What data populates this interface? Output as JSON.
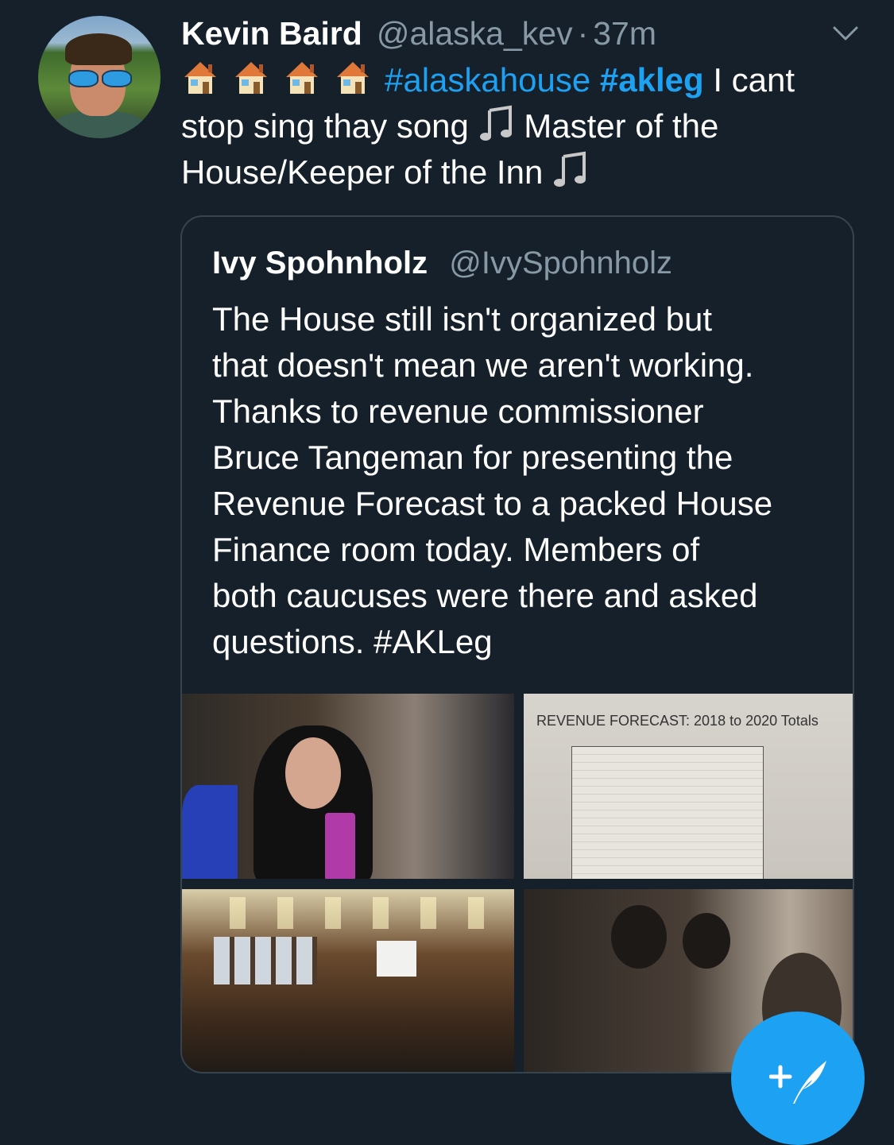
{
  "tweet": {
    "author_name": "Kevin Baird",
    "author_handle": "@alaska_kev",
    "separator": "·",
    "time": "37m",
    "text_hashtag_1": "#alaskahouse",
    "text_hashtag_2": "#akleg",
    "text_after_hashtags": "I cant",
    "text_line_2": "stop sing thay song",
    "text_line_2_after_note": "Master of the",
    "text_line_3": "House/Keeper of the Inn",
    "emojis": [
      "house-emoji",
      "house-emoji",
      "house-emoji",
      "house-emoji",
      "musical-notes-emoji",
      "musical-notes-emoji"
    ]
  },
  "quoted_tweet": {
    "author_name": "Ivy Spohnholz",
    "author_handle": "@IvySpohnholz",
    "text_lines": [
      "The House still isn't organized but",
      "that doesn't mean we aren't working.",
      "Thanks to revenue commissioner",
      "Bruce Tangeman for presenting the",
      "Revenue Forecast to a packed House",
      "Finance room today. Members of",
      "both caucuses were there and asked",
      "questions."
    ],
    "hashtag": "#AKLeg",
    "media": {
      "revenue_forecast_title": "REVENUE FORECAST:  2018 to 2020 Totals"
    }
  },
  "colors": {
    "background": "#15202b",
    "link": "#1da1f2",
    "secondary_text": "#8899a6",
    "border": "#38444d"
  },
  "icons": {
    "caret": "chevron-down-icon",
    "compose": "compose-tweet-icon"
  }
}
